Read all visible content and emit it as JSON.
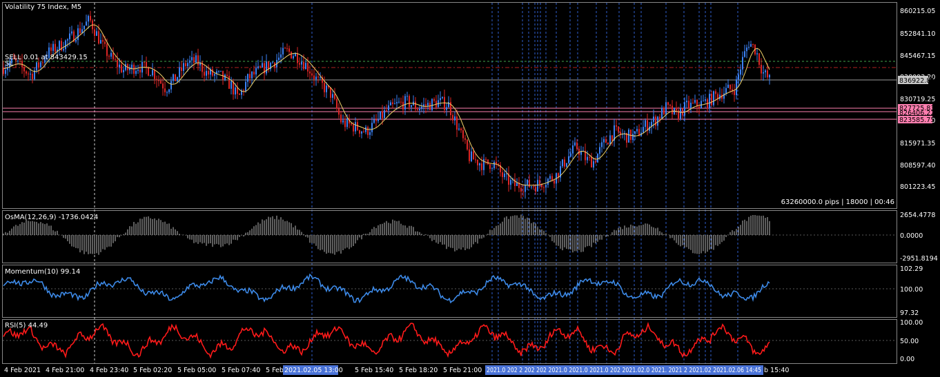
{
  "window": {
    "title": "Volatility 75 Index, M5"
  },
  "colors": {
    "bull": "#3b82f6",
    "bear": "#dc2626",
    "ma": "#f2d46a",
    "grid": "#5a5a5a",
    "vline": "#2f5fd0",
    "osma": "#bdbdbd",
    "momentum": "#3d8ae8",
    "rsi": "#ff1a1a",
    "pink": "#ff7fb0",
    "green_level": "#3fa34d",
    "red_level": "#b22222"
  },
  "price_axis": {
    "labels": [
      "860215.05",
      "852841.10",
      "845467.15",
      "838093.20",
      "830719.25",
      "823345.30",
      "815971.35",
      "808597.40",
      "801223.45"
    ],
    "current_price": "836922.81",
    "level_tags": [
      "827725.83",
      "826406.22",
      "823585.75"
    ]
  },
  "trade": {
    "sell_label": "SELL 0.01 at 843429.15",
    "sl_label": "SL"
  },
  "status": {
    "info": "63260000.0 pips | 18000 | 00:46"
  },
  "osma": {
    "title": "OsMA(12,26,9) -1736.0424",
    "axis": [
      "2654.4778",
      "0.0000",
      "-2951.8194"
    ]
  },
  "momentum": {
    "title": "Momentum(10) 99.14",
    "axis": [
      "102.29",
      "100.00",
      "97.32"
    ]
  },
  "rsi": {
    "title": "RSI(5) 44.49",
    "axis": [
      "100.00",
      "50.00",
      "0.00"
    ]
  },
  "time_axis": {
    "labels": [
      "4 Feb 2021",
      "4 Feb 21:00",
      "4 Feb 23:40",
      "5 Feb 02:20",
      "5 Feb 05:00",
      "5 Feb 07:40",
      "5 Feb",
      "5 Feb 13:00",
      "5 Feb 15:40",
      "5 Feb 18:20",
      "5 Feb 21:00",
      "b 15:40"
    ],
    "highlight_tags": [
      "2021.02.05 13:00",
      "2021.0 202 2 202 202 2021.0 2021.0 2021.0 202 2021.02.0 2021. 2021 2 2021.02 2021.02.06 14:45"
    ]
  },
  "chart_data": {
    "type": "candlestick",
    "symbol": "Volatility 75 Index",
    "timeframe": "M5",
    "y_axis_ticks": [
      860215.05,
      852841.1,
      845467.15,
      838093.2,
      830719.25,
      823345.3,
      815971.35,
      808597.4,
      801223.45
    ],
    "current_price": 836922.81,
    "sell_price": 843429.15,
    "horizontal_levels": [
      827725.83,
      826406.22,
      823585.75
    ],
    "close_path": [
      [
        0,
        840500
      ],
      [
        20,
        843000
      ],
      [
        45,
        838500
      ],
      [
        70,
        846000
      ],
      [
        95,
        849500
      ],
      [
        115,
        853500
      ],
      [
        130,
        857000
      ],
      [
        150,
        847500
      ],
      [
        165,
        843000
      ],
      [
        180,
        840000
      ],
      [
        200,
        841500
      ],
      [
        220,
        840000
      ],
      [
        240,
        834000
      ],
      [
        255,
        837500
      ],
      [
        270,
        842500
      ],
      [
        285,
        843000
      ],
      [
        300,
        839000
      ],
      [
        320,
        838000
      ],
      [
        335,
        835000
      ],
      [
        345,
        830500
      ],
      [
        360,
        837500
      ],
      [
        380,
        840500
      ],
      [
        400,
        843500
      ],
      [
        415,
        846500
      ],
      [
        430,
        845000
      ],
      [
        445,
        841500
      ],
      [
        460,
        836500
      ],
      [
        480,
        832000
      ],
      [
        495,
        822500
      ],
      [
        510,
        821500
      ],
      [
        530,
        819500
      ],
      [
        545,
        822500
      ],
      [
        560,
        826500
      ],
      [
        575,
        828500
      ],
      [
        590,
        829500
      ],
      [
        605,
        827500
      ],
      [
        620,
        828500
      ],
      [
        635,
        829500
      ],
      [
        650,
        828500
      ],
      [
        665,
        820000
      ],
      [
        680,
        811000
      ],
      [
        700,
        808500
      ],
      [
        715,
        809000
      ],
      [
        730,
        804000
      ],
      [
        745,
        801500
      ],
      [
        760,
        801500
      ],
      [
        775,
        801500
      ],
      [
        790,
        803000
      ],
      [
        805,
        804500
      ],
      [
        820,
        810000
      ],
      [
        835,
        814500
      ],
      [
        850,
        810000
      ],
      [
        860,
        809500
      ],
      [
        875,
        815500
      ],
      [
        890,
        819500
      ],
      [
        905,
        818000
      ],
      [
        920,
        818000
      ],
      [
        935,
        821500
      ],
      [
        950,
        823500
      ],
      [
        965,
        827500
      ],
      [
        980,
        825000
      ],
      [
        995,
        828000
      ],
      [
        1010,
        828500
      ],
      [
        1025,
        829500
      ],
      [
        1040,
        832000
      ],
      [
        1055,
        833500
      ],
      [
        1065,
        834000
      ],
      [
        1075,
        843000
      ],
      [
        1085,
        849500
      ],
      [
        1095,
        847000
      ],
      [
        1105,
        839500
      ],
      [
        1115,
        836900
      ]
    ],
    "osma_range": [
      -2951.8194,
      2654.4778
    ],
    "momentum_range": [
      97.32,
      102.29
    ],
    "rsi_range": [
      0,
      100
    ]
  }
}
